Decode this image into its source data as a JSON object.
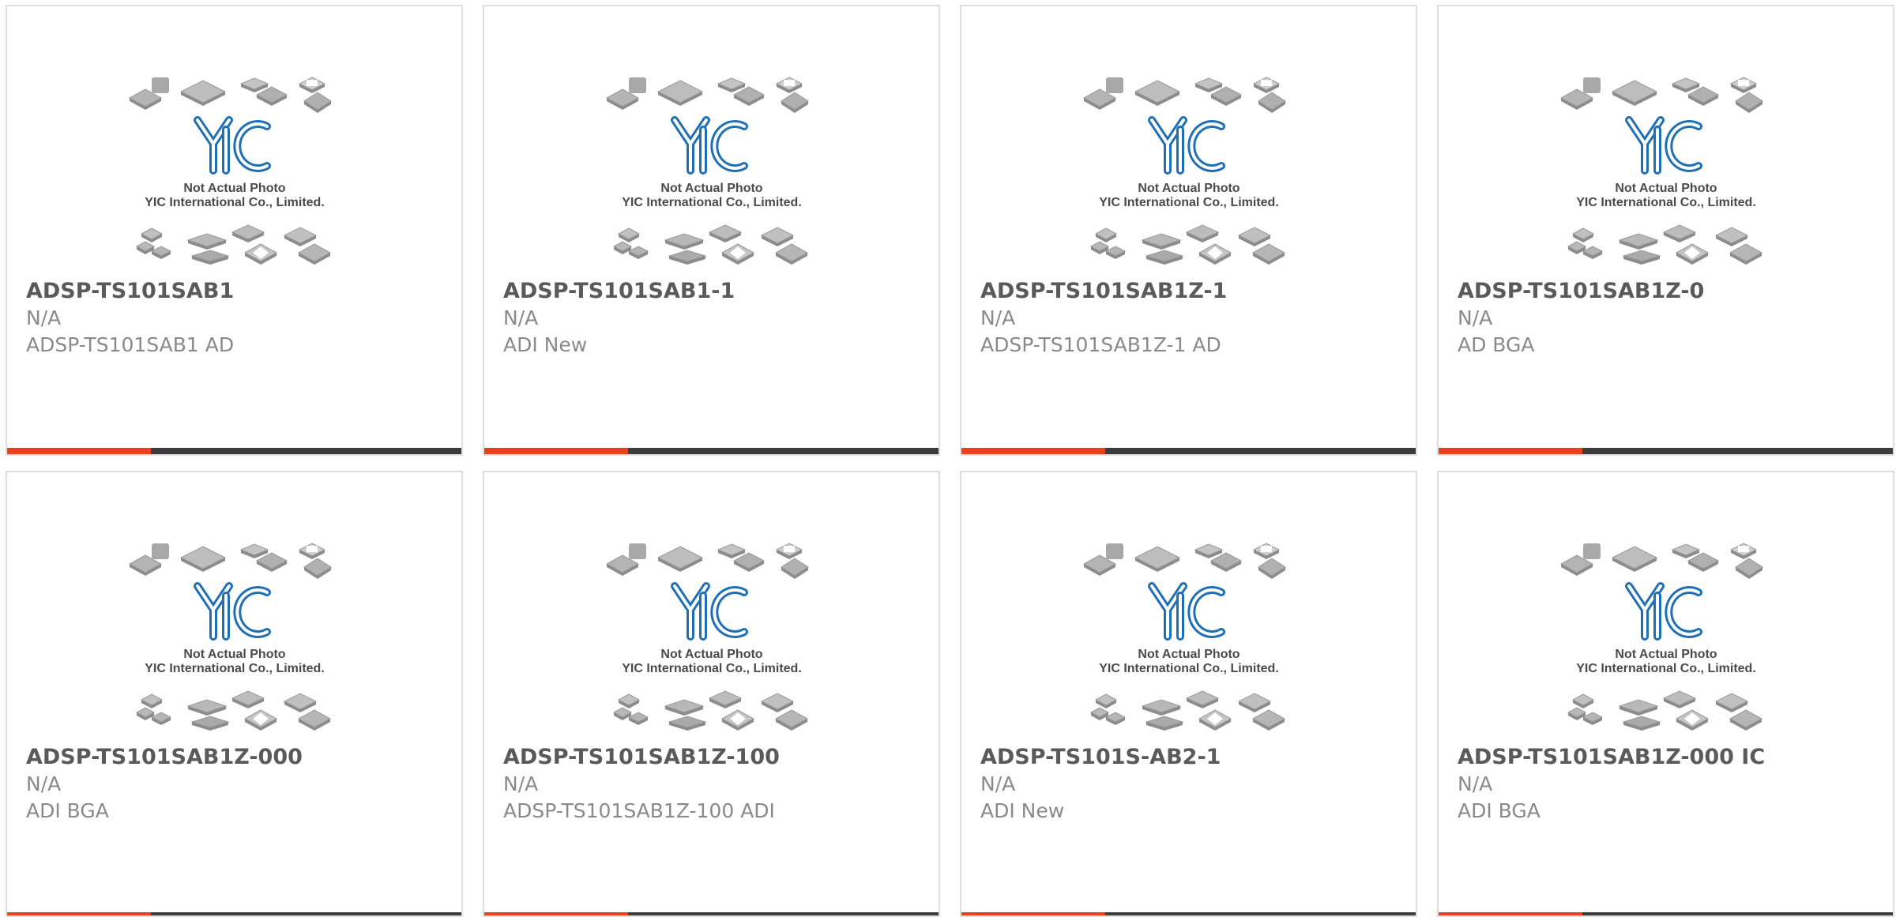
{
  "colors": {
    "accent": "#e8421c",
    "bar": "#3c3c3c",
    "logo": "#1f6fb4"
  },
  "placeholder_image": {
    "icon": "chip-placeholder-image",
    "caption_line1": "Not Actual Photo",
    "caption_line2": "YIC International Co., Limited."
  },
  "products": [
    {
      "part": "ADSP-TS101SAB1",
      "qty": "N/A",
      "desc": "ADSP-TS101SAB1 AD"
    },
    {
      "part": "ADSP-TS101SAB1-1",
      "qty": "N/A",
      "desc": "ADI New"
    },
    {
      "part": "ADSP-TS101SAB1Z-1",
      "qty": "N/A",
      "desc": "ADSP-TS101SAB1Z-1 AD"
    },
    {
      "part": "ADSP-TS101SAB1Z-0",
      "qty": "N/A",
      "desc": "AD BGA"
    },
    {
      "part": "ADSP-TS101SAB1Z-000",
      "qty": "N/A",
      "desc": "ADI BGA"
    },
    {
      "part": "ADSP-TS101SAB1Z-100",
      "qty": "N/A",
      "desc": "ADSP-TS101SAB1Z-100 ADI"
    },
    {
      "part": "ADSP-TS101S-AB2-1",
      "qty": "N/A",
      "desc": "ADI New"
    },
    {
      "part": "ADSP-TS101SAB1Z-000 IC",
      "qty": "N/A",
      "desc": "ADI BGA"
    }
  ]
}
